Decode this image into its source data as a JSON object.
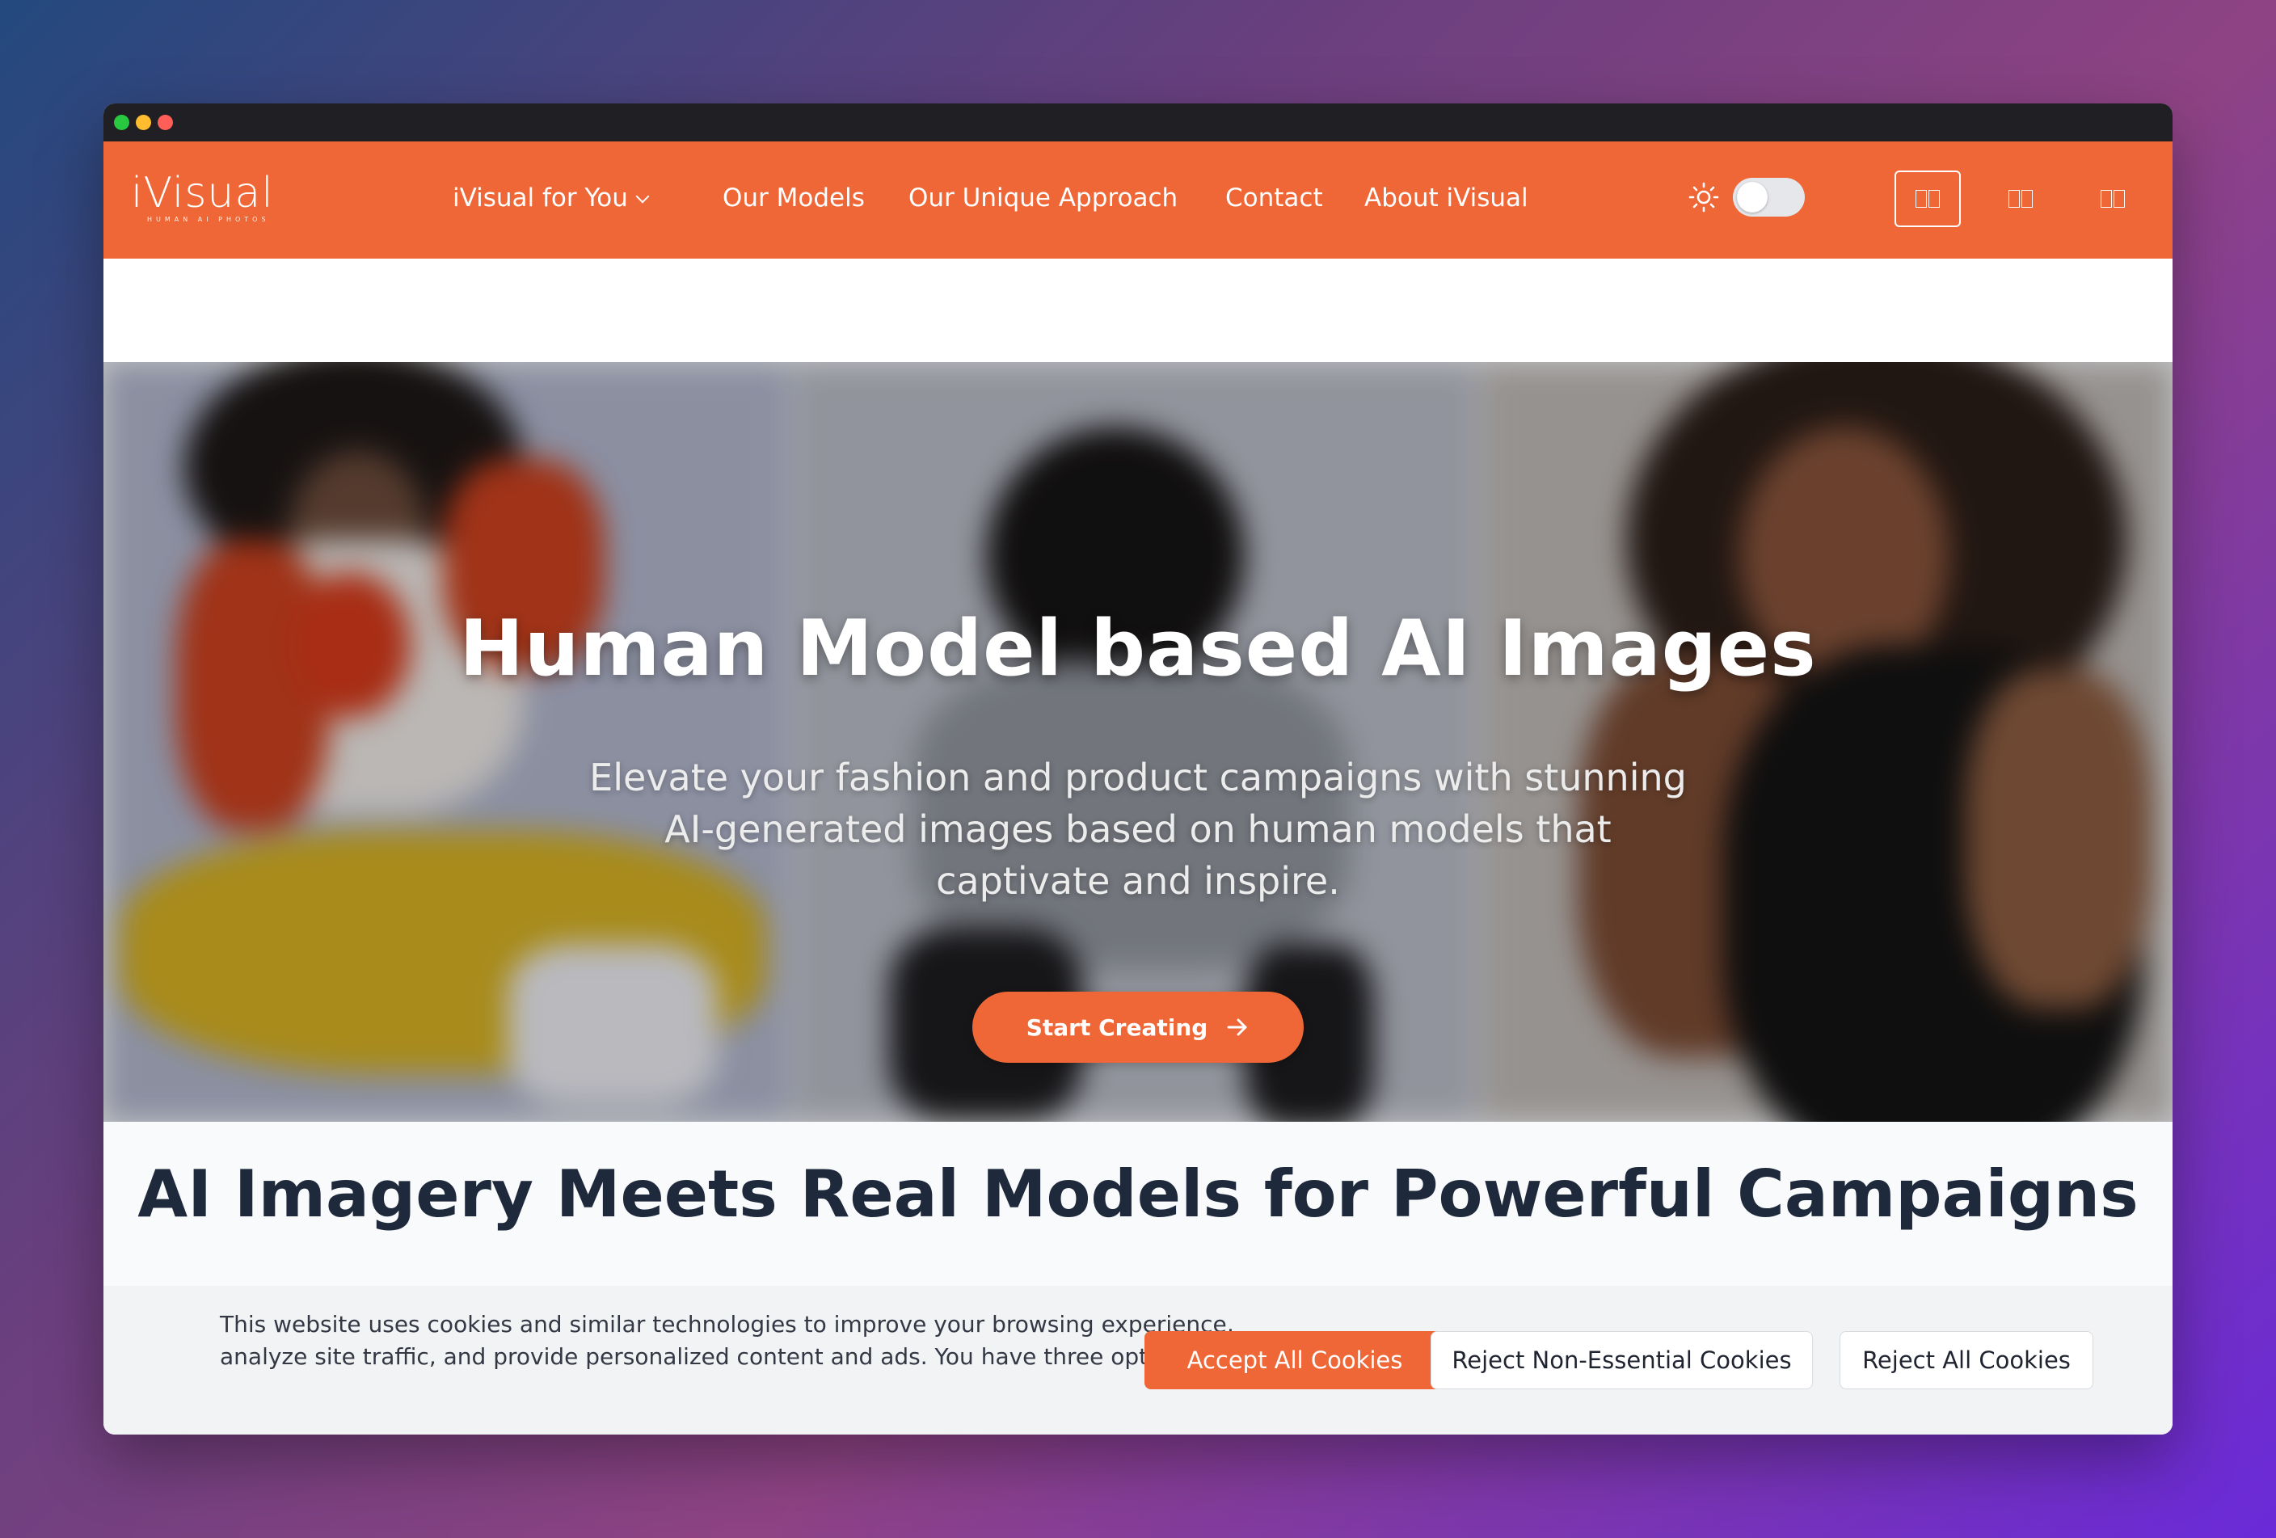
{
  "window": {
    "controls": [
      "green",
      "yellow",
      "red"
    ]
  },
  "navbar": {
    "logo": {
      "main": "iVisual",
      "tagline": "HUMAN AI PHOTOS"
    },
    "links": [
      {
        "label": "iVisual for You",
        "has_dropdown": true
      },
      {
        "label": "Our Models"
      },
      {
        "label": "Our Unique Approach"
      },
      {
        "label": "Contact"
      },
      {
        "label": "About iVisual"
      }
    ],
    "theme_toggle": {
      "icon": "sun-icon",
      "state": "light"
    },
    "language_buttons": [
      {
        "icon": "flag-icon",
        "active": true
      },
      {
        "icon": "flag-icon",
        "active": false
      },
      {
        "icon": "flag-icon",
        "active": false
      }
    ],
    "accent_color": "#ef6736"
  },
  "hero": {
    "title": "Human Model based AI Images",
    "subtitle": "Elevate your fashion and product campaigns with stunning AI-generated images based on human models that captivate and inspire.",
    "cta_label": "Start Creating",
    "cta_icon": "arrow-right-icon"
  },
  "section2": {
    "title": "AI Imagery Meets Real Models for Powerful Campaigns"
  },
  "cookie_banner": {
    "text": "This website uses cookies and similar technologies to improve your browsing experience, analyze site traffic, and provide personalized content and ads. You have three options:",
    "accept_label": "Accept All Cookies",
    "reject_non_essential_label": "Reject Non-Essential Cookies",
    "reject_all_label": "Reject All Cookies"
  }
}
